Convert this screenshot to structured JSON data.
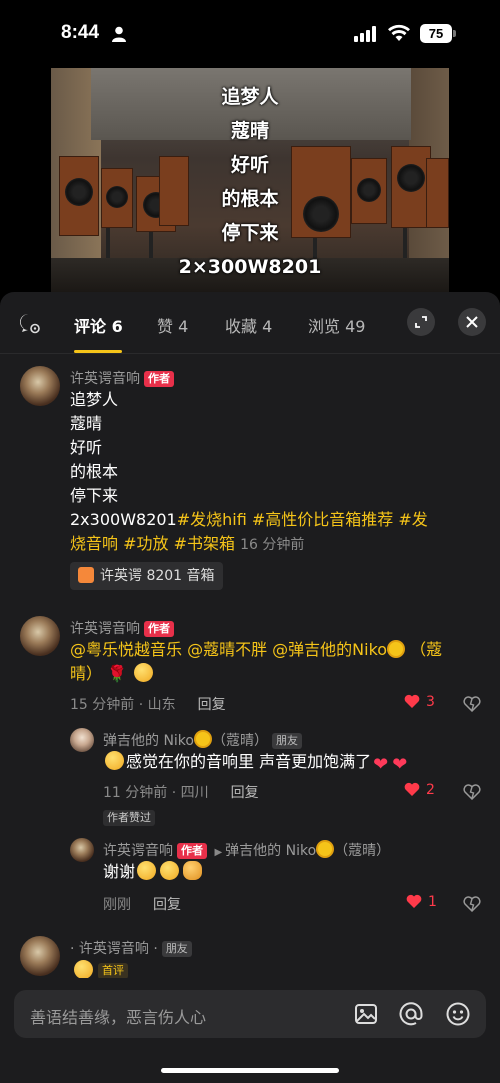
{
  "status": {
    "time": "8:44",
    "battery": "75"
  },
  "media": {
    "overlay_lines": [
      "追梦人",
      "蔻晴",
      "好听",
      "的根本",
      "停下来",
      "2×300W8201"
    ]
  },
  "tabs": [
    {
      "label": "评论 6",
      "active": true
    },
    {
      "label": "赞 4"
    },
    {
      "label": "收藏 4"
    },
    {
      "label": "浏览 49"
    }
  ],
  "comments": {
    "c1": {
      "user": "许英谔音响",
      "author_tag": "作者",
      "lines": [
        "追梦人",
        "蔻晴",
        "好听",
        "的根本",
        "停下来"
      ],
      "line6_plain": "2x300W8201",
      "line6_tags": "#发烧hifi #高性价比音箱推荐 #发",
      "line7_tags": "烧音响 #功放 #书架箱",
      "time": "16 分钟前",
      "product": "许英谔 8201 音箱"
    },
    "c2": {
      "user": "许英谔音响",
      "author_tag": "作者",
      "text_a": "@粤乐悦越音乐 @蔻晴不胖 @弹吉他的Niko",
      "text_b": "（蔻",
      "text_c": "晴）",
      "meta": "15 分钟前 · 山东",
      "reply": "回复",
      "likes": "3"
    },
    "c3": {
      "user": "弹吉他的 Niko",
      "user_suffix": "（蔻晴）",
      "friend_tag": "朋友",
      "text": "感觉在你的音响里 声音更加饱满了",
      "meta": "11 分钟前 · 四川",
      "reply": "回复",
      "likes": "2",
      "badge": "作者赞过"
    },
    "c4": {
      "user": "许英谔音响",
      "author_tag": "作者",
      "reply_to": "弹吉他的 Niko",
      "reply_to_suffix": "（蔻晴）",
      "text": "谢谢",
      "meta": "刚刚",
      "reply": "回复",
      "likes": "1"
    },
    "c5": {
      "user": "· 许英谔音响 ·",
      "friend_tag": "朋友",
      "badge": "首评"
    }
  },
  "input": {
    "placeholder": "善语结善缘，恶言伤人心"
  },
  "colors": {
    "accent": "#f5c419",
    "author_red": "#e8304a",
    "like_red": "#ff3a4a"
  }
}
